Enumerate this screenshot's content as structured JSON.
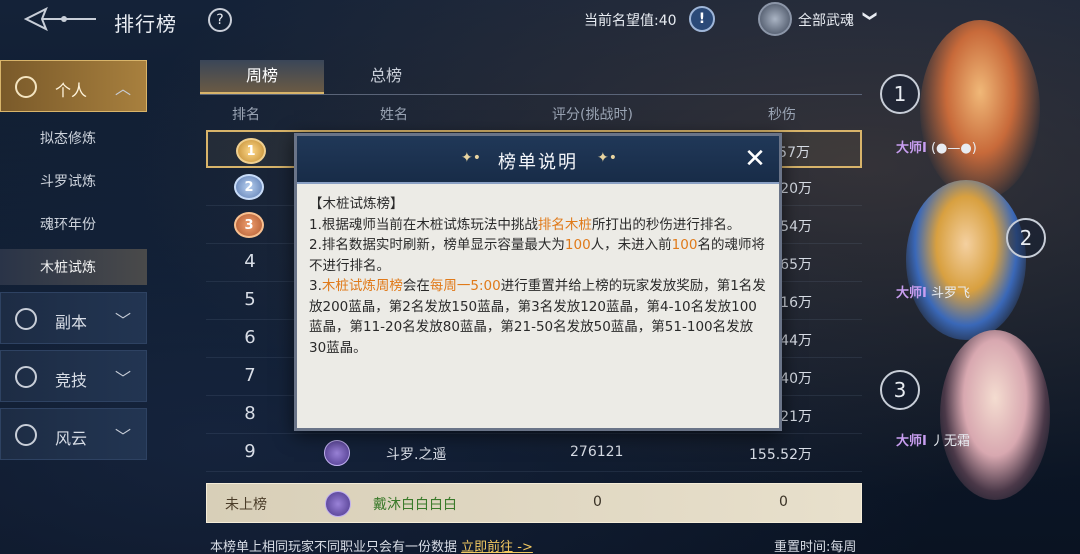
{
  "header": {
    "title": "排行榜",
    "help": "?",
    "prestige_label": "当前名望值:40",
    "alert": "!",
    "soul_filter": "全部武魂",
    "soul_chevron": "❯"
  },
  "sidebar": {
    "categories": [
      {
        "label": "个人",
        "chevron": "︿"
      },
      {
        "label": "副本",
        "chevron": "﹀"
      },
      {
        "label": "竞技",
        "chevron": "﹀"
      },
      {
        "label": "风云",
        "chevron": "﹀"
      }
    ],
    "sub_items": [
      "拟态修炼",
      "斗罗试炼",
      "魂环年份",
      "木桩试炼"
    ]
  },
  "tabs": [
    "周榜",
    "总榜"
  ],
  "columns": [
    "排名",
    "姓名",
    "评分(挑战时)",
    "秒伤"
  ],
  "rows": [
    {
      "rank": "1",
      "name": "",
      "score": "",
      "dps": "57万"
    },
    {
      "rank": "2",
      "name": "",
      "score": "",
      "dps": "20万"
    },
    {
      "rank": "3",
      "name": "",
      "score": "",
      "dps": "54万"
    },
    {
      "rank": "4",
      "name": "",
      "score": "",
      "dps": "65万"
    },
    {
      "rank": "5",
      "name": "",
      "score": "",
      "dps": "16万"
    },
    {
      "rank": "6",
      "name": "",
      "score": "",
      "dps": "44万"
    },
    {
      "rank": "7",
      "name": "",
      "score": "",
      "dps": "40万"
    },
    {
      "rank": "8",
      "name": "",
      "score": "",
      "dps": "21万"
    },
    {
      "rank": "9",
      "name": "斗罗.之遥",
      "score": "276121",
      "dps": "155.52万"
    }
  ],
  "self_row": {
    "rank": "未上榜",
    "name": "戴沐白白白白",
    "score": "0",
    "dps": "0"
  },
  "footer": {
    "note": "本榜单上相同玩家不同职业只会有一份数据",
    "link": "立即前往 ->",
    "reset": "重置时间:每周"
  },
  "top_players": [
    {
      "rank": "1",
      "title": "大师Ⅰ",
      "name": "(●—●)"
    },
    {
      "rank": "2",
      "title": "大师Ⅰ",
      "name": "斗罗飞"
    },
    {
      "rank": "3",
      "title": "大师Ⅰ",
      "name": "丿无霜"
    }
  ],
  "modal": {
    "title": "榜单说明",
    "deco": "✦•",
    "close": "✕",
    "lines": [
      "【木桩试炼榜】",
      "1.根据魂师当前在木桩试炼玩法中挑战",
      "排名木桩",
      "所打出的秒伤进行排名。",
      "2.排名数据实时刷新，榜单显示容量最大为",
      "100",
      "人，未进入前",
      "名的魂师将不进行排名。",
      "3.",
      "木桩试炼周榜",
      "会在",
      "每周一5:00",
      "进行重置并给上榜的玩家发放奖励，",
      "第1名发放200蓝晶，第2名发放150蓝晶，第3名发放120蓝晶，第4-10名发放100蓝晶，第11-20名发放80蓝晶，第21-50名发放50蓝晶，第51-100名发放30蓝晶。"
    ]
  },
  "colors": {
    "accent_gold": "#d8b46a",
    "highlight_orange": "#e07a1a",
    "name_green": "#3a7a2a"
  }
}
